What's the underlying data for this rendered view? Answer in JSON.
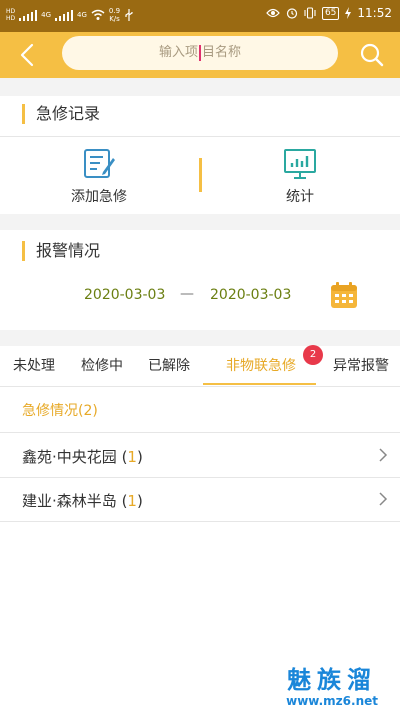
{
  "status_bar": {
    "hd_a": "HD",
    "hd_b": "HD",
    "net_a": "4G",
    "net_b": "4G",
    "speed_value": "0.9",
    "speed_unit": "K/s",
    "battery": "65",
    "time": "11:52"
  },
  "header": {
    "search_placeholder_start": "输入项",
    "search_placeholder_end": "目名称"
  },
  "repair_records": {
    "title": "急修记录",
    "add_label": "添加急修",
    "stats_label": "统计"
  },
  "alarm": {
    "title": "报警情况",
    "start_date": "2020-03-03",
    "separator": "—",
    "end_date": "2020-03-03"
  },
  "tabs": {
    "items": [
      {
        "label": "未处理"
      },
      {
        "label": "检修中"
      },
      {
        "label": "已解除"
      },
      {
        "label": "非物联急修"
      },
      {
        "label": "异常报警"
      }
    ],
    "active_index": 3,
    "badge": "2"
  },
  "summary": {
    "label": "急修情况(2)"
  },
  "list": [
    {
      "name": "鑫苑·中央花园",
      "open": "(",
      "count": "1",
      "close": ")"
    },
    {
      "name": "建业·森林半岛",
      "open": "(",
      "count": "1",
      "close": ")"
    }
  ],
  "watermark": {
    "big": "魅族溜",
    "small": "www.mz6.net"
  },
  "colors": {
    "status_bar": "#9a6a12",
    "accent": "#f5bf44",
    "accent_text": "#e7a927",
    "date_text": "#6b7f12",
    "badge": "#e8394a",
    "icon_blue": "#3a8fc4",
    "icon_teal": "#2aa8a0"
  },
  "icons": {
    "back": "chevron-left-icon",
    "search": "search-icon",
    "add": "edit-document-icon",
    "stats": "bar-chart-icon",
    "calendar": "calendar-icon",
    "row": "chevron-right-icon"
  }
}
